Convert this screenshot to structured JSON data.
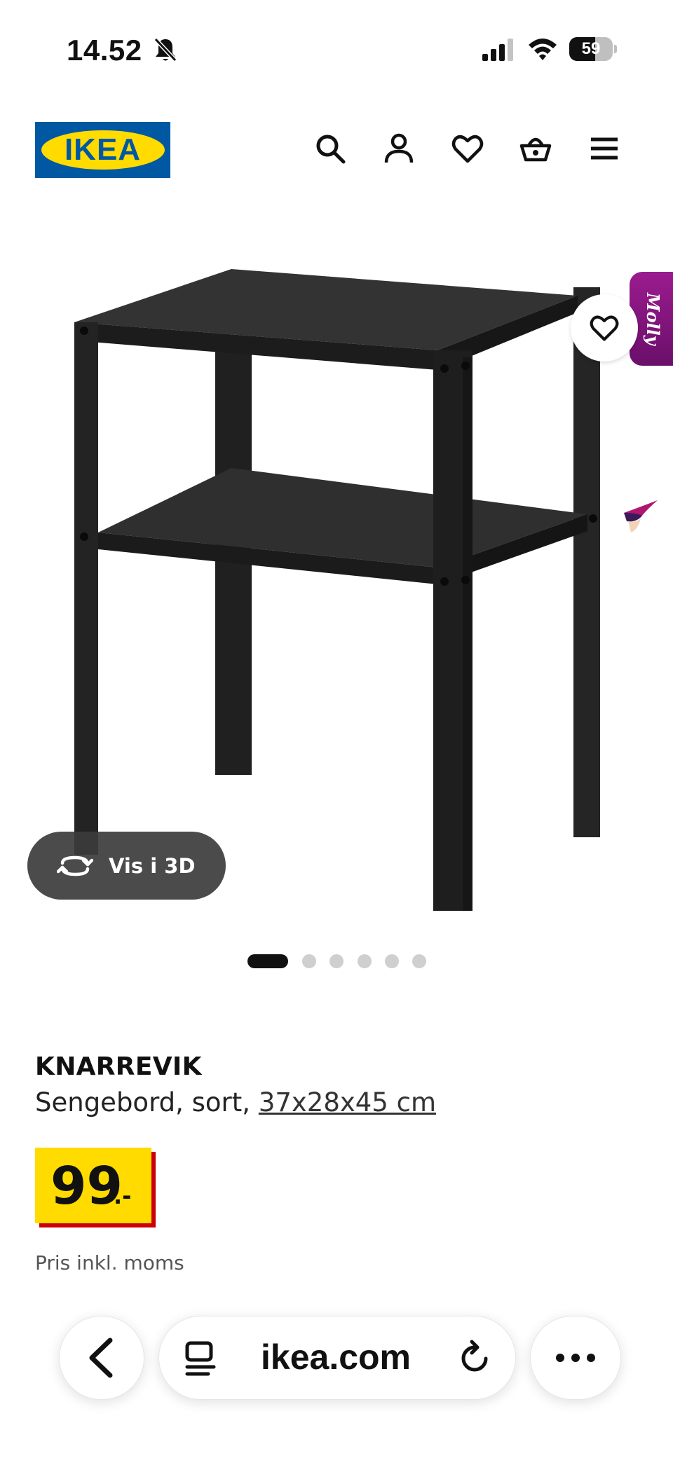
{
  "status_bar": {
    "time": "14.52",
    "battery_level": "59",
    "battery_fraction": 0.59,
    "icons": [
      "bell-slash-icon",
      "cellular-signal-icon",
      "wifi-icon",
      "battery-icon"
    ]
  },
  "header": {
    "logo_text": "IKEA",
    "brand_colors": {
      "blue": "#0058a3",
      "yellow": "#ffdb00",
      "red": "#cc0008"
    },
    "icons": [
      "search-icon",
      "user-icon",
      "heart-icon",
      "basket-icon",
      "menu-icon"
    ]
  },
  "gallery": {
    "view_3d_label": "Vis i 3D",
    "assistant_tab_label": "Molly",
    "image_count": 6,
    "active_image_index": 0
  },
  "product": {
    "name": "KNARREVIK",
    "description": "Sengebord, sort, ",
    "size": "37x28x45 cm",
    "price_integer": "99",
    "price_decimal": ".-",
    "vat_note": "Pris inkl. moms"
  },
  "browser": {
    "url": "ikea.com",
    "icons": [
      "back-chevron-icon",
      "tabs-icon",
      "reload-icon",
      "more-icon"
    ]
  }
}
